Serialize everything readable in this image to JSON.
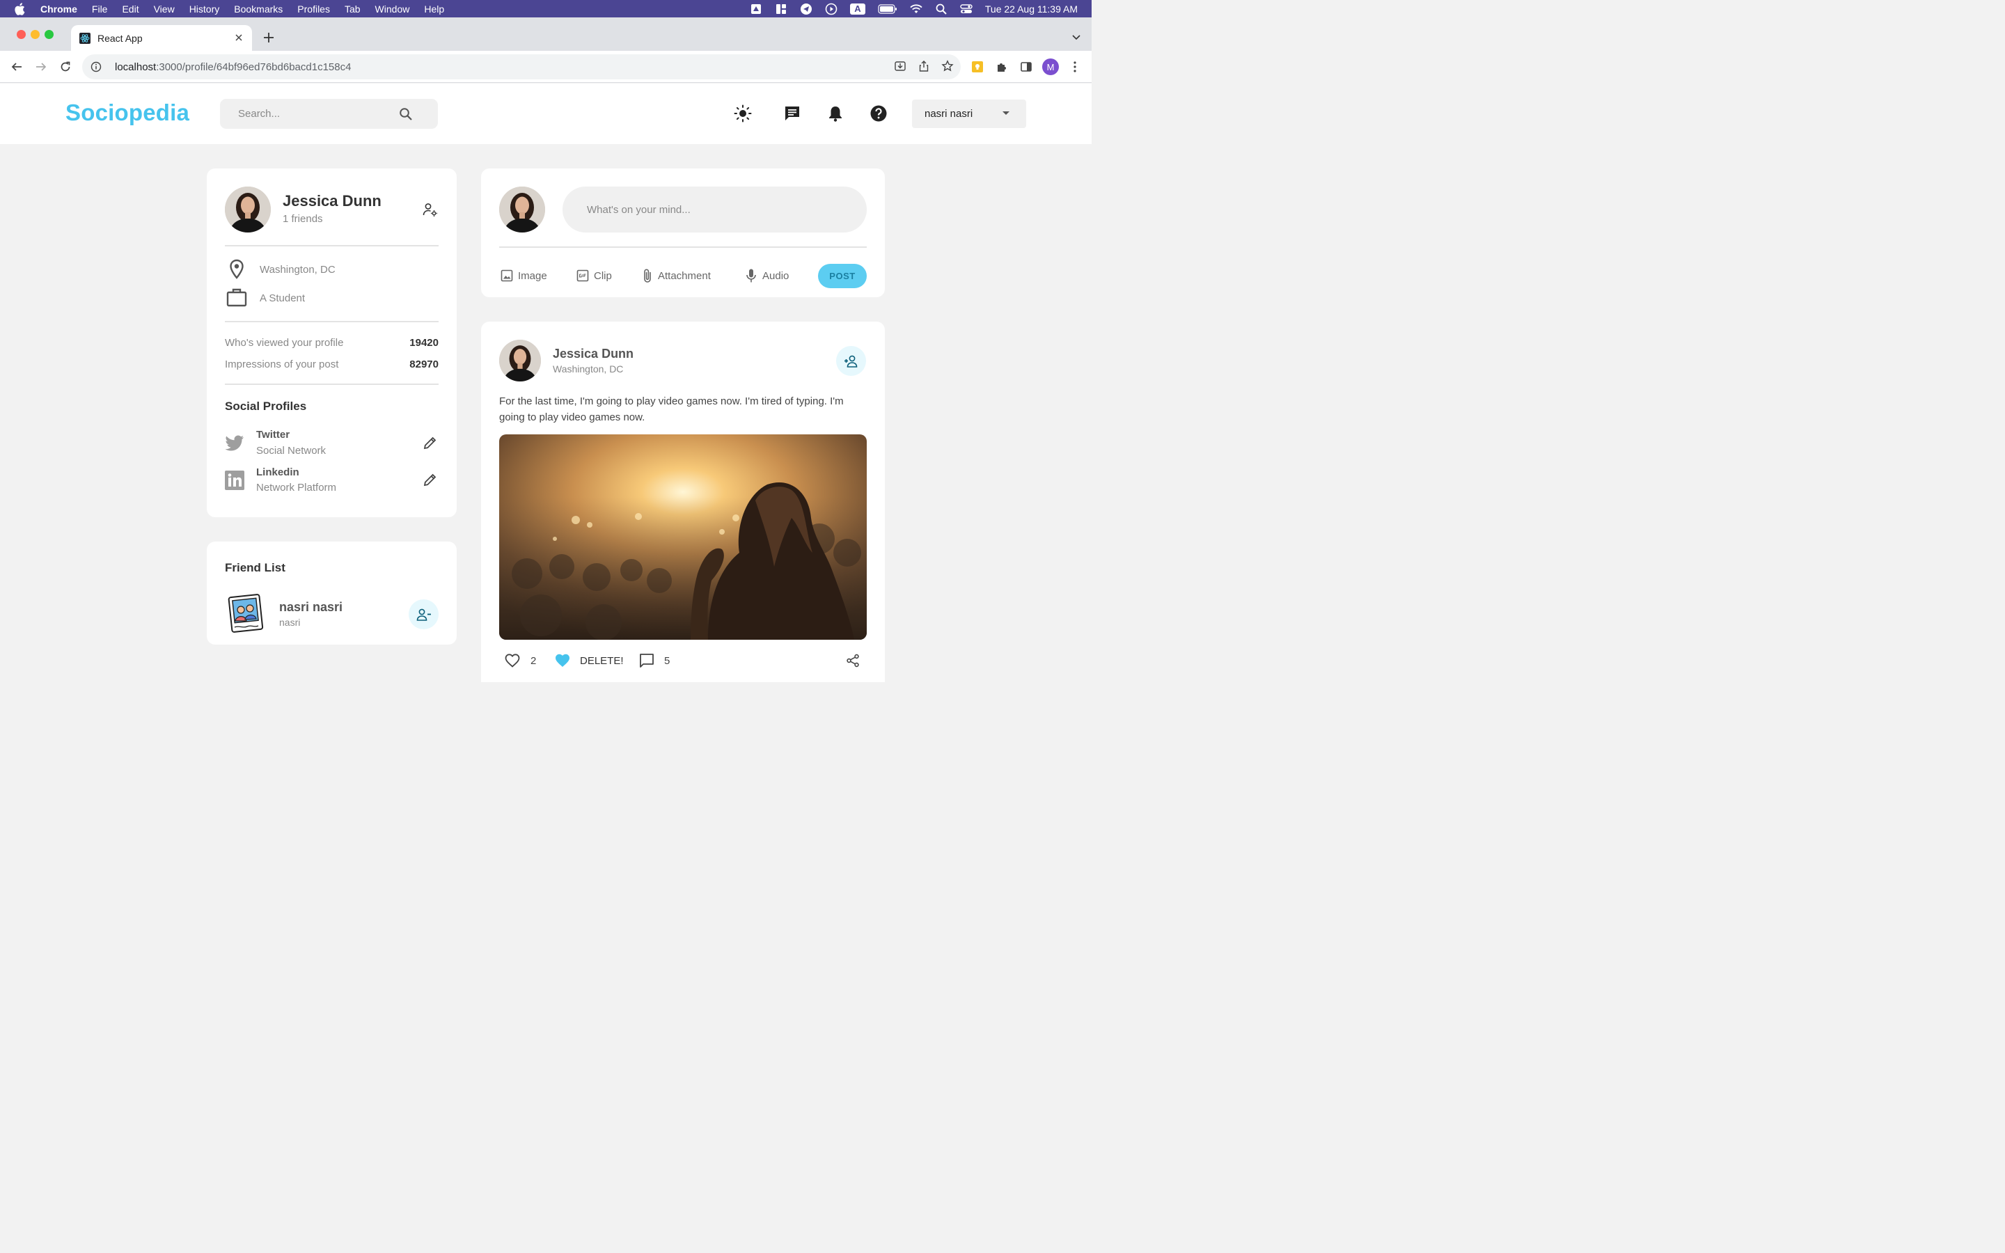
{
  "menubar": {
    "app": "Chrome",
    "items": [
      "File",
      "Edit",
      "View",
      "History",
      "Bookmarks",
      "Profiles",
      "Tab",
      "Window",
      "Help"
    ],
    "datetime": "Tue 22 Aug  11:39 AM",
    "status_icons": [
      "drive-icon",
      "grid-icon",
      "telegram-icon",
      "play-icon",
      "keyboard-a-icon",
      "battery-icon",
      "wifi-icon",
      "spotlight-icon",
      "control-center-icon"
    ],
    "keyboard_label": "A"
  },
  "browser": {
    "tab_title": "React App",
    "url_host": "localhost",
    "url_path": ":3000/profile/64bf96ed76bd6bacd1c158c4",
    "profile_initial": "M",
    "colors": {
      "menubar": "#4b4593",
      "tabstrip": "#dfe1e5",
      "profile": "#7b4fcf"
    }
  },
  "app": {
    "logo": "Sociopedia",
    "search_placeholder": "Search...",
    "user_menu": "nasri nasri",
    "accent": "#46c3ed"
  },
  "profile": {
    "name": "Jessica Dunn",
    "friends": "1 friends",
    "location": "Washington, DC",
    "occupation": "A Student",
    "stats": [
      {
        "label": "Who's viewed your profile",
        "value": "19420"
      },
      {
        "label": "Impressions of your post",
        "value": "82970"
      }
    ],
    "social_title": "Social Profiles",
    "social": [
      {
        "name": "Twitter",
        "sub": "Social Network"
      },
      {
        "name": "Linkedin",
        "sub": "Network Platform"
      }
    ]
  },
  "friend_list": {
    "title": "Friend List",
    "friends": [
      {
        "name": "nasri nasri",
        "sub": "nasri"
      }
    ]
  },
  "composer": {
    "placeholder": "What's on your mind...",
    "actions": [
      "Image",
      "Clip",
      "Attachment",
      "Audio"
    ],
    "post_label": "POST"
  },
  "post": {
    "author": "Jessica Dunn",
    "location": "Washington, DC",
    "text_line1": "For the last time, I'm going to play video games now. I'm tired of typing. I'm",
    "text_line2": "going to play video games now.",
    "likes": "2",
    "delete_label": "DELETE!",
    "comments": "5"
  }
}
